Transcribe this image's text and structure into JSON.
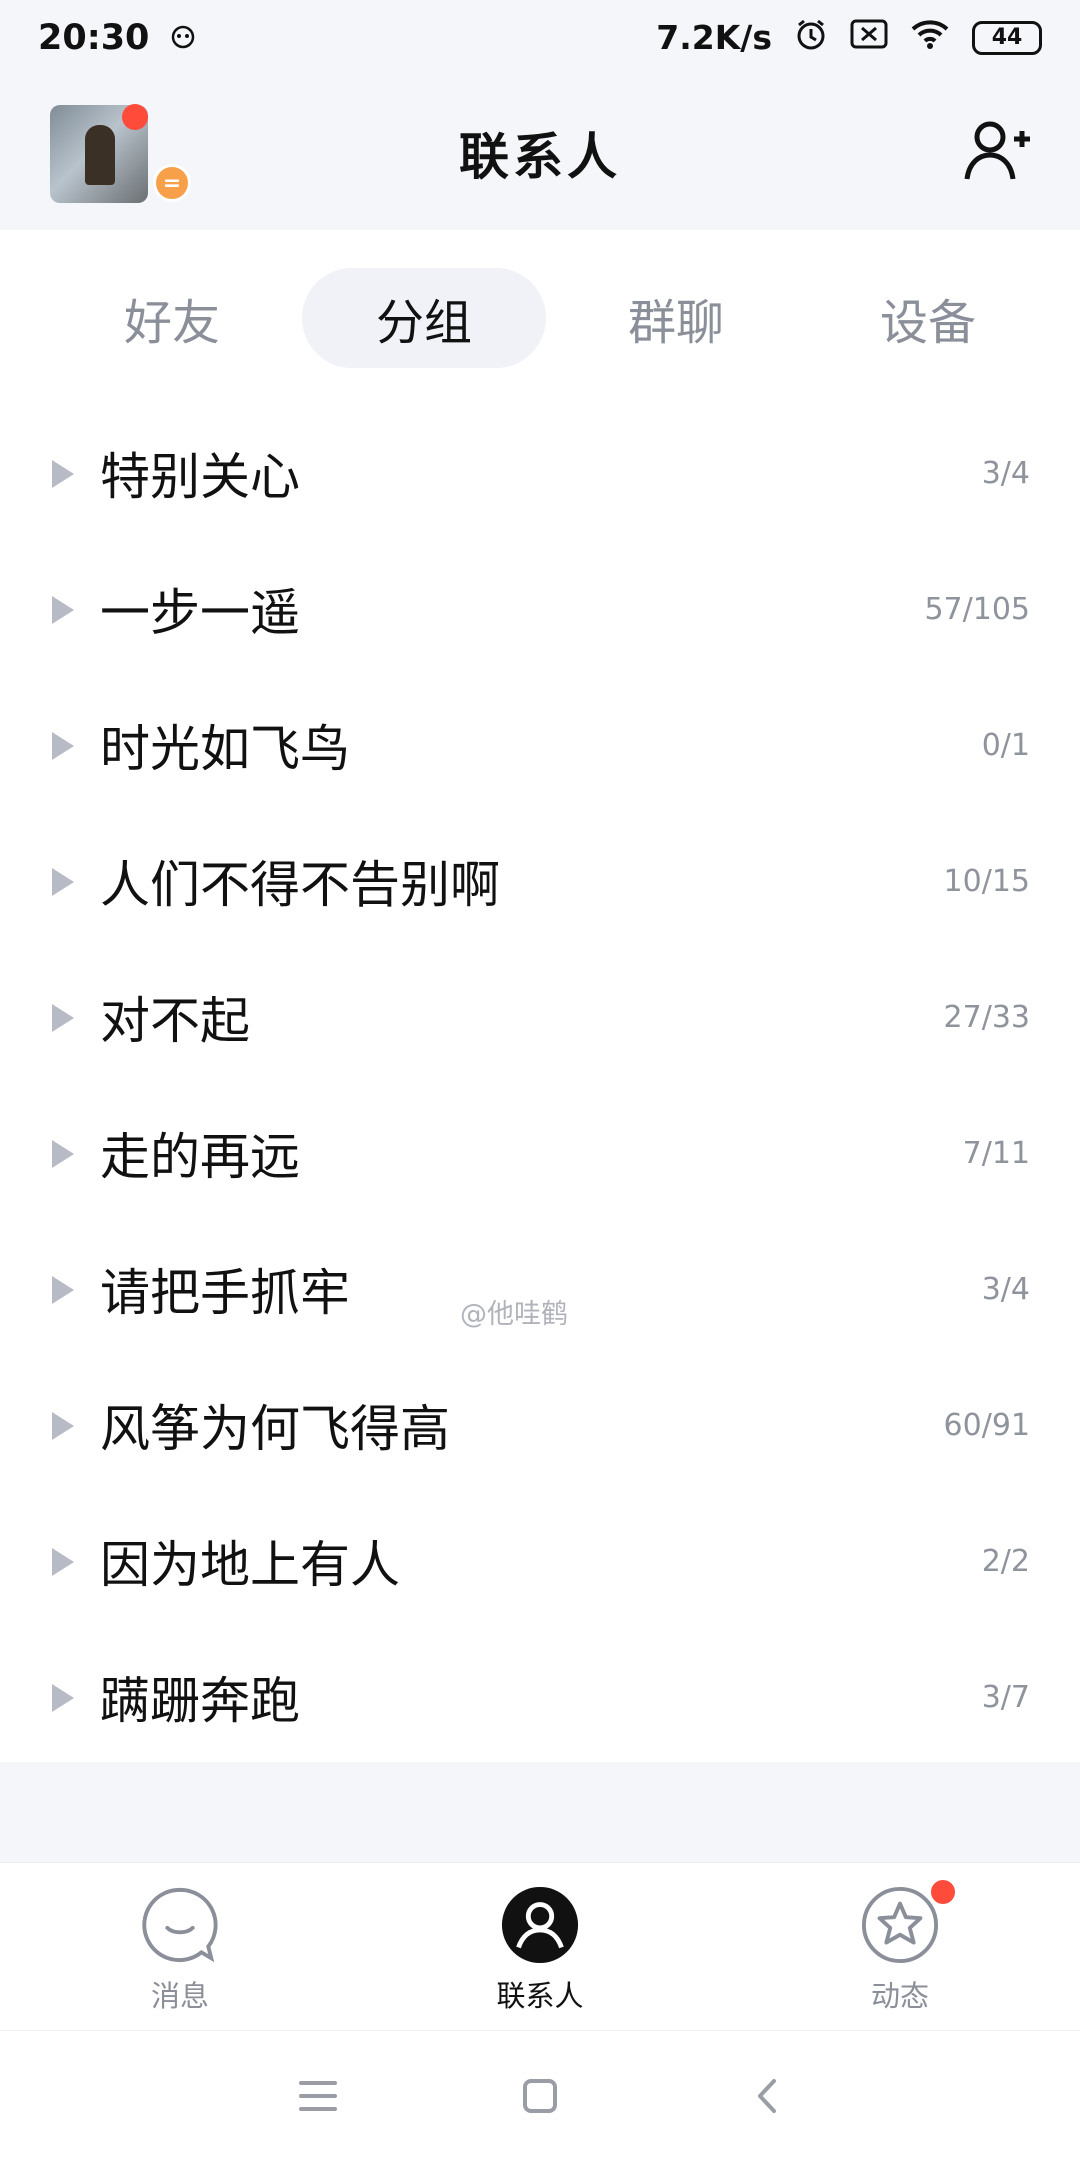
{
  "status_bar": {
    "time": "20:30",
    "network_speed": "7.2K/s",
    "battery_level": "44",
    "icons": [
      "notification-icon",
      "alarm-icon",
      "sim-icon",
      "wifi-icon",
      "battery-icon"
    ]
  },
  "header": {
    "title": "联系人",
    "status_badge": "="
  },
  "tabs": [
    {
      "label": "好友",
      "active": false
    },
    {
      "label": "分组",
      "active": true
    },
    {
      "label": "群聊",
      "active": false
    },
    {
      "label": "设备",
      "active": false
    }
  ],
  "groups": [
    {
      "name": "特别关心",
      "count": "3/4"
    },
    {
      "name": "一步一遥",
      "count": "57/105"
    },
    {
      "name": "时光如飞鸟",
      "count": "0/1"
    },
    {
      "name": "人们不得不告别啊",
      "count": "10/15"
    },
    {
      "name": "对不起",
      "count": "27/33"
    },
    {
      "name": "走的再远",
      "count": "7/11"
    },
    {
      "name": "请把手抓牢",
      "count": "3/4"
    },
    {
      "name": "风筝为何飞得高",
      "count": "60/91"
    },
    {
      "name": "因为地上有人",
      "count": "2/2"
    },
    {
      "name": "蹒跚奔跑",
      "count": "3/7"
    }
  ],
  "watermark": "@他哇鹤",
  "bottom_nav": [
    {
      "label": "消息",
      "icon": "message-bubble-icon",
      "active": false
    },
    {
      "label": "联系人",
      "icon": "contact-person-icon",
      "active": true
    },
    {
      "label": "动态",
      "icon": "star-icon",
      "active": false
    }
  ],
  "colors": {
    "accent_dark": "#111111",
    "badge_red": "#ff4b3a",
    "status_orange": "#f7a049",
    "muted_text": "#8b8f99",
    "page_bg": "#f5f6fa"
  }
}
